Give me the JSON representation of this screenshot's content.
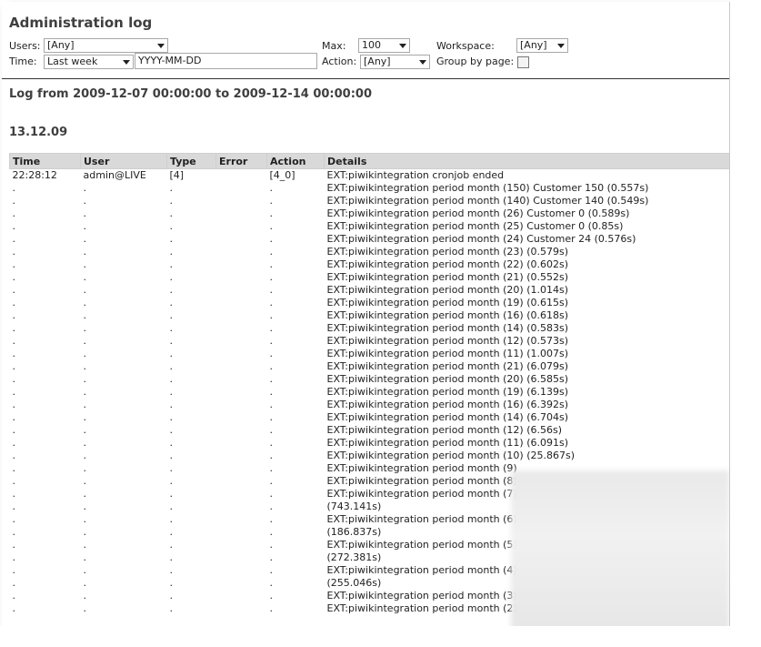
{
  "page": {
    "title": "Administration log",
    "filters": {
      "users_label": "Users:",
      "users_value": "[Any]",
      "time_label": "Time:",
      "time_value": "Last week",
      "date_placeholder": "YYYY-MM-DD",
      "max_label": "Max:",
      "max_value": "100",
      "action_label": "Action:",
      "action_value": "[Any]",
      "workspace_label": "Workspace:",
      "workspace_value": "[Any]",
      "groupby_label": "Group by page:"
    },
    "range_heading": "Log from 2009-12-07 00:00:00 to 2009-12-14 00:00:00",
    "date_heading": "13.12.09"
  },
  "log": {
    "columns": [
      "Time",
      "User",
      "Type",
      "Error",
      "Action",
      "Details"
    ],
    "first_row": {
      "time": "22:28:12",
      "user": "admin@LIVE",
      "type": "[4]",
      "error": "",
      "action": "[4_0]",
      "details": "EXT:piwikintegration cronjob ended"
    },
    "dot": ".",
    "rows": [
      "EXT:piwikintegration period month (150) Customer 150 (0.557s)",
      "EXT:piwikintegration period month (140) Customer 140 (0.549s)",
      "EXT:piwikintegration period month (26) Customer 0 (0.589s)",
      "EXT:piwikintegration period month (25) Customer 0 (0.85s)",
      "EXT:piwikintegration period month (24) Customer 24 (0.576s)",
      "EXT:piwikintegration period month (23) (0.579s)",
      "EXT:piwikintegration period month (22) (0.602s)",
      "EXT:piwikintegration period month (21) (0.552s)",
      "EXT:piwikintegration period month (20) (1.014s)",
      "EXT:piwikintegration period month (19) (0.615s)",
      "EXT:piwikintegration period month (16) (0.618s)",
      "EXT:piwikintegration period month (14) (0.583s)",
      "EXT:piwikintegration period month (12) (0.573s)",
      "EXT:piwikintegration period month (11) (1.007s)",
      "EXT:piwikintegration period month (21) (6.079s)",
      "EXT:piwikintegration period month (20) (6.585s)",
      "EXT:piwikintegration period month (19) (6.139s)",
      "EXT:piwikintegration period month (16) (6.392s)",
      "EXT:piwikintegration period month (14) (6.704s)",
      "EXT:piwikintegration period month (12) (6.56s)",
      "EXT:piwikintegration period month (11) (6.091s)",
      "EXT:piwikintegration period month (10) (25.867s)",
      "EXT:piwikintegration period month (9)",
      "EXT:piwikintegration period month (8)",
      "EXT:piwikintegration period month (7)",
      "(743.141s)",
      "EXT:piwikintegration period month (6)",
      "(186.837s)",
      "EXT:piwikintegration period month (5)",
      "(272.381s)",
      "EXT:piwikintegration period month (4)",
      "(255.046s)",
      "EXT:piwikintegration period month (3)",
      "EXT:piwikintegration period month (2)"
    ]
  }
}
